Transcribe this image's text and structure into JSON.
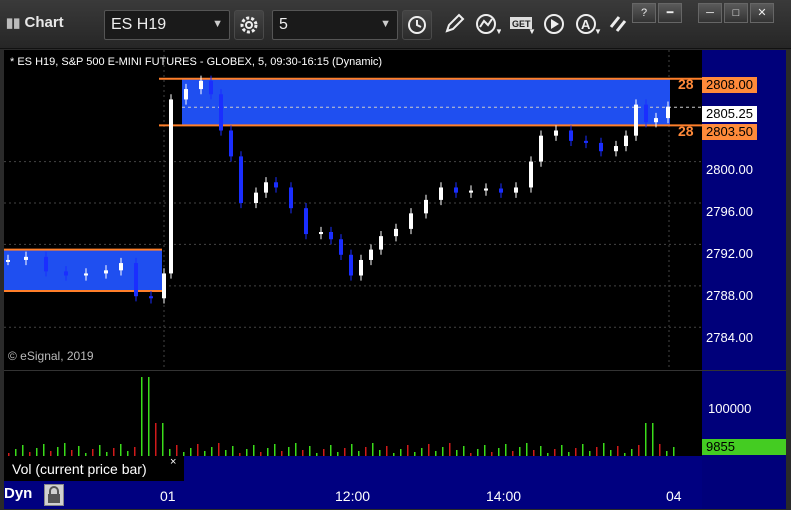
{
  "window": {
    "title": "Chart",
    "symbol": "ES H19",
    "interval": "5"
  },
  "chart": {
    "legend": "* ES H19, S&P 500 E-MINI FUTURES - GLOBEX, 5, 09:30-16:15 (Dynamic)",
    "copyright": "© eSignal, 2019",
    "price_labels": [
      "2800.00",
      "2796.00",
      "2792.00",
      "2788.00",
      "2784.00"
    ],
    "zone_tags": [
      "2808.00",
      "2805.25",
      "2803.50"
    ],
    "zone_prefix_top": "28",
    "zone_prefix_bottom": "28",
    "vol_labels": [
      "100000",
      "9855"
    ],
    "time_labels": [
      "01",
      "12:00",
      "14:00",
      "04"
    ]
  },
  "volume_panel": {
    "label": "Vol (current price bar)",
    "close": "×"
  },
  "status": {
    "dyn": "Dyn"
  },
  "colors": {
    "zone": "#1f4ff0",
    "zone_line": "#ff7f2a",
    "bull": "#ffffff",
    "bear": "#1a2eff",
    "vol_up": "#3adc1a",
    "vol_down": "#d11a1a",
    "last_tag": "#44cc22"
  },
  "chart_data": {
    "type": "candlestick",
    "ylim": [
      2782,
      2810
    ],
    "upper_zone": [
      2803.5,
      2808.0
    ],
    "lower_zone": [
      2787.5,
      2791.5
    ],
    "last_price": 2805.25
  }
}
